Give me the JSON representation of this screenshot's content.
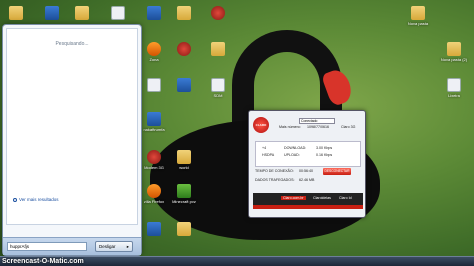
{
  "desktop": {
    "icons": [
      {
        "label": "",
        "type": "folder"
      },
      {
        "label": "",
        "type": "app"
      },
      {
        "label": "",
        "type": "folder"
      },
      {
        "label": "",
        "type": "doc"
      },
      {
        "label": "",
        "type": "app"
      },
      {
        "label": "",
        "type": "folder"
      },
      {
        "label": "",
        "type": "red"
      },
      {
        "label": "Zona",
        "type": "orange"
      },
      {
        "label": "",
        "type": "red"
      },
      {
        "label": "",
        "type": "folder"
      },
      {
        "label": "",
        "type": "doc"
      },
      {
        "label": "",
        "type": "app"
      },
      {
        "label": "SDM",
        "type": "doc"
      },
      {
        "label": "nakaftrumfa",
        "type": "app"
      },
      {
        "label": "Modem 3G",
        "type": "red"
      },
      {
        "label": "world",
        "type": "folder"
      },
      {
        "label": "zilla Firefox",
        "type": "orange"
      },
      {
        "label": "Minecraft pvz",
        "type": "green"
      },
      {
        "label": "",
        "type": "app"
      },
      {
        "label": "",
        "type": "folder"
      },
      {
        "label": "Nova pasta",
        "type": "folder"
      },
      {
        "label": "Nova pasta (2)",
        "type": "folder"
      },
      {
        "label": "Lixeira",
        "type": "doc"
      }
    ]
  },
  "start_menu": {
    "searching_text": "Pesquisando...",
    "more_results": "Ver mais resultados",
    "search_value": "hupprAfjs",
    "shutdown_label": "Desligar"
  },
  "dialer": {
    "logo_text": "CLARO",
    "status_value": "Conectado",
    "phone_label": "Mais número:",
    "phone_value": "1098/77/0616",
    "plan_label": "Claro 3G",
    "signal_label": "+4",
    "network_label": "HSDPA",
    "download_label": "DOWNLOAD:",
    "download_value": "3.00 Kbps",
    "upload_label": "UPLOAD:",
    "upload_value": "0.16 Kbps",
    "time_label": "TEMPO DE CONEXÃO:",
    "time_value": "00:56:40",
    "data_label": "DADOS TRAFEGADOS:",
    "data_value": "62.46 MB",
    "disconnect_label": "DESCONECTAR",
    "banner_items": [
      "Claro.com.br",
      "Claroideias",
      "Claro Id"
    ]
  },
  "watermark": "Screencast-O-Matic.com"
}
